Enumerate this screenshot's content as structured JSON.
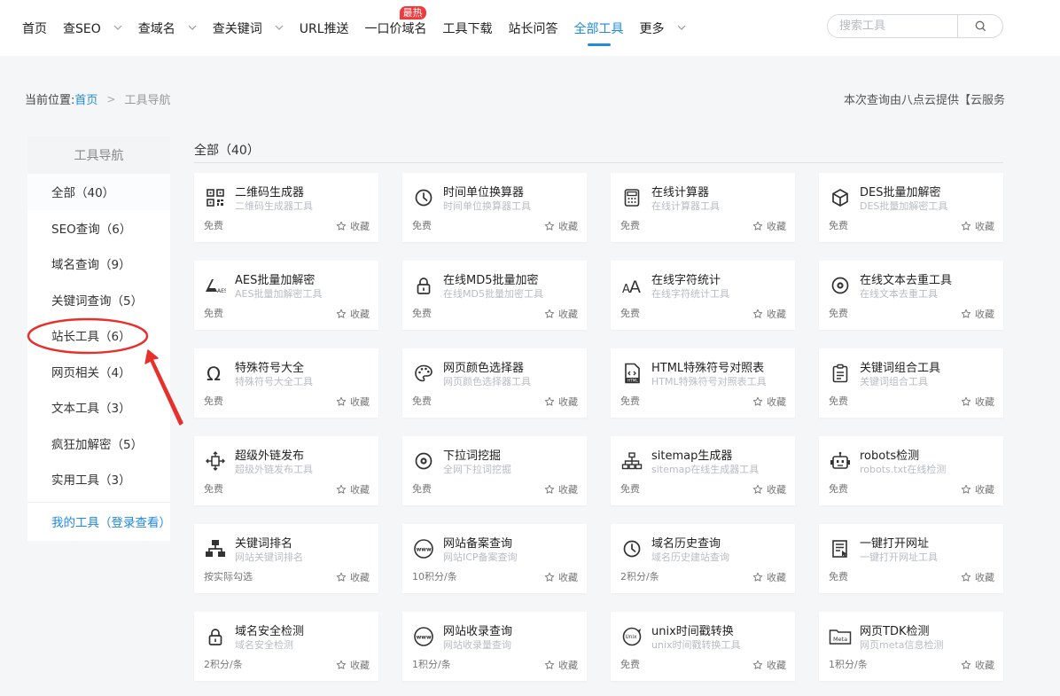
{
  "nav": {
    "items": [
      {
        "label": "首页",
        "dropdown": false,
        "active": false
      },
      {
        "label": "查SEO",
        "dropdown": true,
        "active": false
      },
      {
        "label": "查域名",
        "dropdown": true,
        "active": false
      },
      {
        "label": "查关键词",
        "dropdown": true,
        "active": false
      },
      {
        "label": "URL推送",
        "dropdown": false,
        "active": false
      },
      {
        "label": "一口价域名",
        "dropdown": false,
        "active": false,
        "badge": "最热"
      },
      {
        "label": "工具下载",
        "dropdown": false,
        "active": false
      },
      {
        "label": "站长问答",
        "dropdown": false,
        "active": false
      },
      {
        "label": "全部工具",
        "dropdown": false,
        "active": true
      },
      {
        "label": "更多",
        "dropdown": true,
        "active": false
      }
    ],
    "search_placeholder": "搜索工具",
    "accent": "#1e8ae0",
    "badge_color": "#ef3b3b"
  },
  "breadcrumb": {
    "prefix": "当前位置:",
    "home": "首页",
    "current": "工具导航"
  },
  "provider_text": "本次查询由八点云提供【云服务",
  "sidebar": {
    "title": "工具导航",
    "items": [
      {
        "label": "全部（40）"
      },
      {
        "label": "SEO查询（6）"
      },
      {
        "label": "域名查询（9）"
      },
      {
        "label": "关键词查询（5）"
      },
      {
        "label": "站长工具（6）"
      },
      {
        "label": "网页相关（4）"
      },
      {
        "label": "文本工具（3）"
      },
      {
        "label": "疯狂加解密（5）"
      },
      {
        "label": "实用工具（3）"
      }
    ],
    "my_tools": "我的工具（登录查看）"
  },
  "content": {
    "title": "全部（40）",
    "fav_label": "收藏",
    "tools": [
      {
        "name": "二维码生成器",
        "desc": "二维码生成器工具",
        "price": "免费",
        "icon": "qrcode-icon"
      },
      {
        "name": "时间单位换算器",
        "desc": "时间单位换算器工具",
        "price": "免费",
        "icon": "clock-icon"
      },
      {
        "name": "在线计算器",
        "desc": "在线计算器工具",
        "price": "免费",
        "icon": "calculator-icon"
      },
      {
        "name": "DES批量加解密",
        "desc": "DES批量加解密工具",
        "price": "免费",
        "icon": "cube-icon"
      },
      {
        "name": "AES批量加解密",
        "desc": "AES批量加解密工具",
        "price": "免费",
        "icon": "aes-icon"
      },
      {
        "name": "在线MD5批量加密",
        "desc": "在线MD5批量加密工具",
        "price": "免费",
        "icon": "lock-icon"
      },
      {
        "name": "在线字符统计",
        "desc": "在线字符统计工具",
        "price": "免费",
        "icon": "font-size-icon"
      },
      {
        "name": "在线文本去重工具",
        "desc": "在线文本去重工具",
        "price": "免费",
        "icon": "circle-dot-icon"
      },
      {
        "name": "特殊符号大全",
        "desc": "特殊符号大全工具",
        "price": "免费",
        "icon": "omega-icon"
      },
      {
        "name": "网页颜色选择器",
        "desc": "网页颜色选择器工具",
        "price": "免费",
        "icon": "palette-icon"
      },
      {
        "name": "HTML特殊符号对照表",
        "desc": "HTML特殊符号对照表工具",
        "price": "免费",
        "icon": "html-file-icon"
      },
      {
        "name": "关键词组合工具",
        "desc": "关键词组合工具",
        "price": "免费",
        "icon": "clipboard-list-icon"
      },
      {
        "name": "超级外链发布",
        "desc": "超级外链发布工具",
        "price": "免费",
        "icon": "link-arrows-icon"
      },
      {
        "name": "下拉词挖掘",
        "desc": "全网下拉词挖掘",
        "price": "免费",
        "icon": "circle-dot-icon"
      },
      {
        "name": "sitemap生成器",
        "desc": "sitemap在线生成器工具",
        "price": "免费",
        "icon": "sitemap-icon"
      },
      {
        "name": "robots检测",
        "desc": "robots.txt在线检测",
        "price": "免费",
        "icon": "robot-icon"
      },
      {
        "name": "关键词排名",
        "desc": "网站关键词排名",
        "price": "按实际勾选",
        "icon": "hierarchy-icon"
      },
      {
        "name": "网站备案查询",
        "desc": "网站ICP备案查询",
        "price": "10积分/条",
        "icon": "www-icon"
      },
      {
        "name": "域名历史查询",
        "desc": "域名历史建站查询",
        "price": "2积分/条",
        "icon": "clock-icon"
      },
      {
        "name": "一键打开网址",
        "desc": "一键打开网址工具",
        "price": "免费",
        "icon": "document-list-icon"
      },
      {
        "name": "域名安全检测",
        "desc": "域名安全检测",
        "price": "2积分/条",
        "icon": "lock-icon"
      },
      {
        "name": "网站收录查询",
        "desc": "网站收录量查询",
        "price": "1积分/条",
        "icon": "www-icon"
      },
      {
        "name": "unix时间戳转换",
        "desc": "unix时间戳转换工具",
        "price": "免费",
        "icon": "unix-clock-icon"
      },
      {
        "name": "网页TDK检测",
        "desc": "网页meta信息检测",
        "price": "1积分/条",
        "icon": "meta-folder-icon"
      }
    ]
  },
  "annotation_color": "#e8302a"
}
